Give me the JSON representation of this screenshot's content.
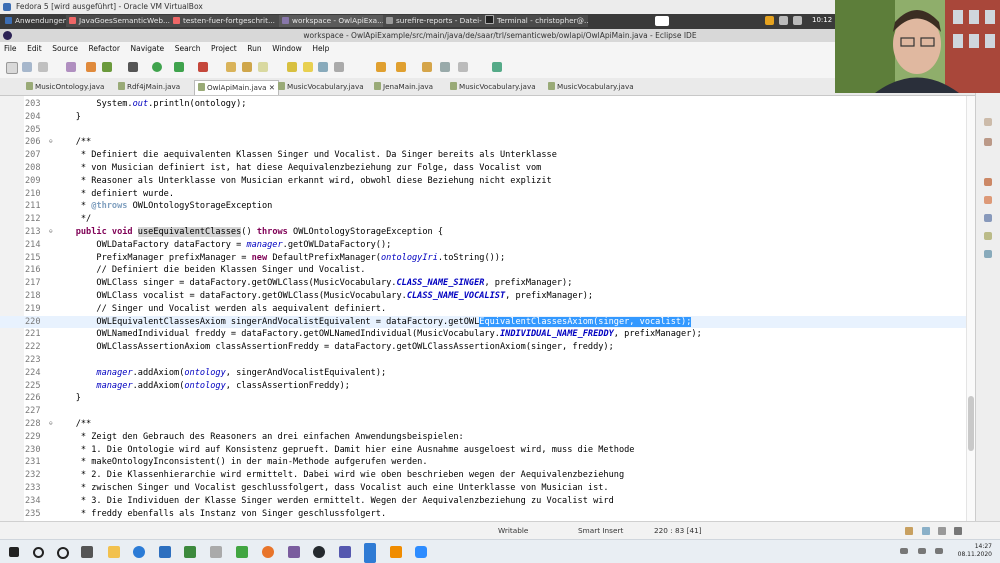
{
  "vbox": {
    "title": "Fedora 5 [wird ausgeführt] - Oracle VM VirtualBox"
  },
  "fedora_taskbar": {
    "items": [
      "Anwendungen",
      "JavaGoesSemanticWeb...",
      "testen-fuer-fortgeschrit...",
      "workspace - OwlApiExa...",
      "surefire-reports - Datei-v...",
      "Terminal - christopher@..."
    ],
    "clock": "10:12"
  },
  "window": {
    "title": "workspace - OwlApiExample/src/main/java/de/saar/trl/semanticweb/owlapi/OwlApiMain.java - Eclipse IDE"
  },
  "menu": [
    "File",
    "Edit",
    "Source",
    "Refactor",
    "Navigate",
    "Search",
    "Project",
    "Run",
    "Window",
    "Help"
  ],
  "tabs": [
    {
      "label": "MusicOntology.java",
      "active": false
    },
    {
      "label": "Rdf4jMain.java",
      "active": false
    },
    {
      "label": "OwlApiMain.java",
      "active": true
    },
    {
      "label": "MusicVocabulary.java",
      "active": false
    },
    {
      "label": "JenaMain.java",
      "active": false
    },
    {
      "label": "MusicVocabulary.java",
      "active": false
    },
    {
      "label": "MusicVocabulary.java",
      "active": false
    }
  ],
  "line_numbers": [
    "203",
    "204",
    "205",
    "206",
    "207",
    "208",
    "209",
    "210",
    "211",
    "212",
    "213",
    "214",
    "215",
    "216",
    "217",
    "218",
    "219",
    "220",
    "221",
    "222",
    "223",
    "224",
    "225",
    "226",
    "227",
    "228",
    "229",
    "230",
    "231",
    "232",
    "233",
    "234",
    "235"
  ],
  "code": {
    "l203a": "        System.",
    "l203b": "out",
    "l203c": ".println(ontology);",
    "l204": "    }",
    "l206": "    /**",
    "l207": "     * Definiert die aequivalenten Klassen Singer und Vocalist. Da Singer bereits als Unterklasse",
    "l208": "     * von Musician definiert ist, hat diese Aequivalenzbeziehung zur Folge, dass Vocalist vom",
    "l209": "     * Reasoner als Unterklasse von Musician erkannt wird, obwohl diese Beziehung nicht explizit",
    "l210": "     * definiert wurde.",
    "l211a": "     * ",
    "l211b": "@throws",
    "l211c": " OWLOntologyStorageException",
    "l212": "     */",
    "l213a": "    public void ",
    "l213b": "useEquivalentClasses",
    "l213c": "() ",
    "l213d": "throws",
    "l213e": " OWLOntologyStorageException {",
    "l214a": "        OWLDataFactory dataFactory = ",
    "l214b": "manager",
    "l214c": ".getOWLDataFactory();",
    "l215a": "        PrefixManager prefixManager = ",
    "l215b": "new",
    "l215c": " DefaultPrefixManager(",
    "l215d": "ontologyIri",
    "l215e": ".toString());",
    "l216": "        // Definiert die beiden Klassen Singer und Vocalist.",
    "l217a": "        OWLClass singer = dataFactory.getOWLClass(MusicVocabulary.",
    "l217b": "CLASS_NAME_SINGER",
    "l217c": ", prefixManager);",
    "l218a": "        OWLClass vocalist = dataFactory.getOWLClass(MusicVocabulary.",
    "l218b": "CLASS_NAME_VOCALIST",
    "l218c": ", prefixManager);",
    "l219": "        // Singer und Vocalist werden als aequivalent definiert.",
    "l220a": "        OWLEquivalentClassesAxiom singerAndVocalistEquivalent = dataFactory.getOWL",
    "l220b": "EquivalentClassesAxiom(singer, vocalist);",
    "l221a": "        OWLNamedIndividual freddy = dataFactory.getOWLNamedIndividual(MusicVocabulary.",
    "l221b": "INDIVIDUAL_NAME_FREDDY",
    "l221c": ", prefixManager);",
    "l222": "        OWLClassAssertionAxiom classAssertionFreddy = dataFactory.getOWLClassAssertionAxiom(singer, freddy);",
    "l224a": "        ",
    "l224b": "manager",
    "l224c": ".addAxiom(",
    "l224d": "ontology",
    "l224e": ", singerAndVocalistEquivalent);",
    "l225a": "        ",
    "l225b": "manager",
    "l225c": ".addAxiom(",
    "l225d": "ontology",
    "l225e": ", classAssertionFreddy);",
    "l226": "    }",
    "l228": "    /**",
    "l229": "     * Zeigt den Gebrauch des Reasoners an drei einfachen Anwendungsbeispielen:",
    "l230": "     * 1. Die Ontologie wird auf Konsistenz geprueft. Damit hier eine Ausnahme ausgeloest wird, muss die Methode",
    "l231": "     * makeOntologyInconsistent() in der main-Methode aufgerufen werden.",
    "l232": "     * 2. Die Klassenhierarchie wird ermittelt. Dabei wird wie oben beschrieben wegen der Aequivalenzbeziehung",
    "l233": "     * zwischen Singer und Vocalist geschlussfolgert, dass Vocalist auch eine Unterklasse von Musician ist.",
    "l234": "     * 3. Die Individuen der Klasse Singer werden ermittelt. Wegen der Aequivalenzbeziehung zu Vocalist wird",
    "l235": "     * freddy ebenfalls als Instanz von Singer geschlussfolgert."
  },
  "status": {
    "writable": "Writable",
    "insert_mode": "Smart Insert",
    "position": "220 : 83 [41]"
  },
  "win_clock": {
    "time": "14:27",
    "date": "08.11.2020"
  },
  "colors": {
    "comment": "#3f5fbf",
    "keyword": "#7f0055",
    "field": "#0000c0",
    "selection": "#3399ff",
    "current_line": "#e8f2fe"
  },
  "icons": [
    "fedora-icon",
    "windows-start-icon",
    "search-icon",
    "cortana-icon",
    "explorer-icon",
    "edge-icon",
    "virtualbox-icon",
    "camtasia-icon",
    "firefox-icon",
    "github-icon",
    "teams-icon",
    "snip-icon",
    "vlc-icon",
    "zoom-icon"
  ]
}
